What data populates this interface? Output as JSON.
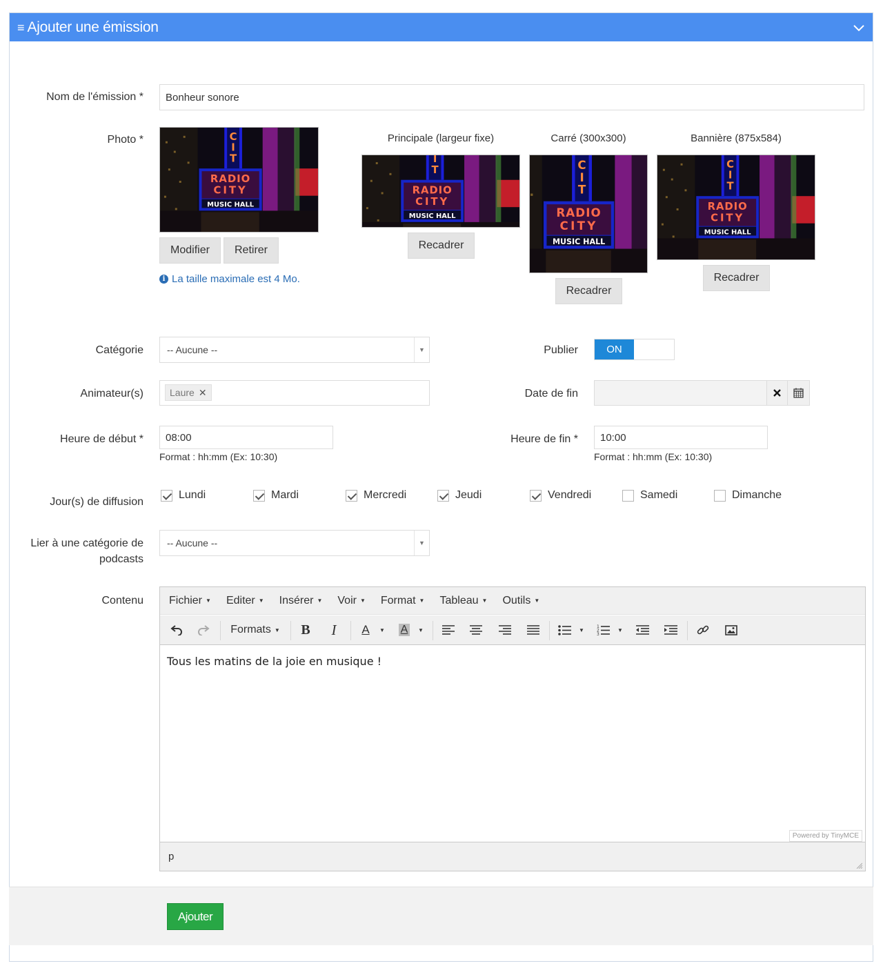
{
  "header": {
    "title": "Ajouter une émission",
    "menu_icon": "≡"
  },
  "fields": {
    "name_label": "Nom de l'émission *",
    "name_value": "Bonheur sonore",
    "photo_label": "Photo *",
    "modify_label": "Modifier",
    "remove_label": "Retirer",
    "max_size_hint": "La taille maximale est 4 Mo.",
    "crops": [
      {
        "title": "Principale (largeur fixe)",
        "button": "Recadrer"
      },
      {
        "title": "Carré (300x300)",
        "button": "Recadrer"
      },
      {
        "title": "Bannière (875x584)",
        "button": "Recadrer"
      }
    ],
    "category_label": "Catégorie",
    "category_value": "-- Aucune --",
    "publish_label": "Publier",
    "publish_value": "ON",
    "hosts_label": "Animateur(s)",
    "hosts_tags": [
      "Laure"
    ],
    "end_date_label": "Date de fin",
    "end_date_value": "",
    "start_time_label": "Heure de début *",
    "start_time_value": "08:00",
    "start_time_format": "Format : hh:mm (Ex: 10:30)",
    "end_time_label": "Heure de fin *",
    "end_time_value": "10:00",
    "end_time_format": "Format : hh:mm (Ex: 10:30)",
    "days_label": "Jour(s) de diffusion",
    "days": [
      {
        "label": "Lundi",
        "checked": true
      },
      {
        "label": "Mardi",
        "checked": true
      },
      {
        "label": "Mercredi",
        "checked": true
      },
      {
        "label": "Jeudi",
        "checked": true
      },
      {
        "label": "Vendredi",
        "checked": true
      },
      {
        "label": "Samedi",
        "checked": false
      },
      {
        "label": "Dimanche",
        "checked": false
      }
    ],
    "podcast_label_line1": "Lier à une catégorie de",
    "podcast_label_line2": "podcasts",
    "podcast_value": "-- Aucune --",
    "content_label": "Contenu"
  },
  "editor": {
    "menu": [
      "Fichier",
      "Editer",
      "Insérer",
      "Voir",
      "Format",
      "Tableau",
      "Outils"
    ],
    "formats_label": "Formats",
    "body_text": "Tous les matins de la joie en musique !",
    "powered_by": "Powered by TinyMCE",
    "path": "p"
  },
  "photo_sign": {
    "line1": "RADIO",
    "line2": "CITY",
    "line3": "MUSIC HALL"
  },
  "footer": {
    "submit_label": "Ajouter"
  },
  "colors": {
    "header": "#4a8ef0",
    "toggle_on": "#1e88d8",
    "submit": "#28a745",
    "hint": "#2a6db5"
  }
}
